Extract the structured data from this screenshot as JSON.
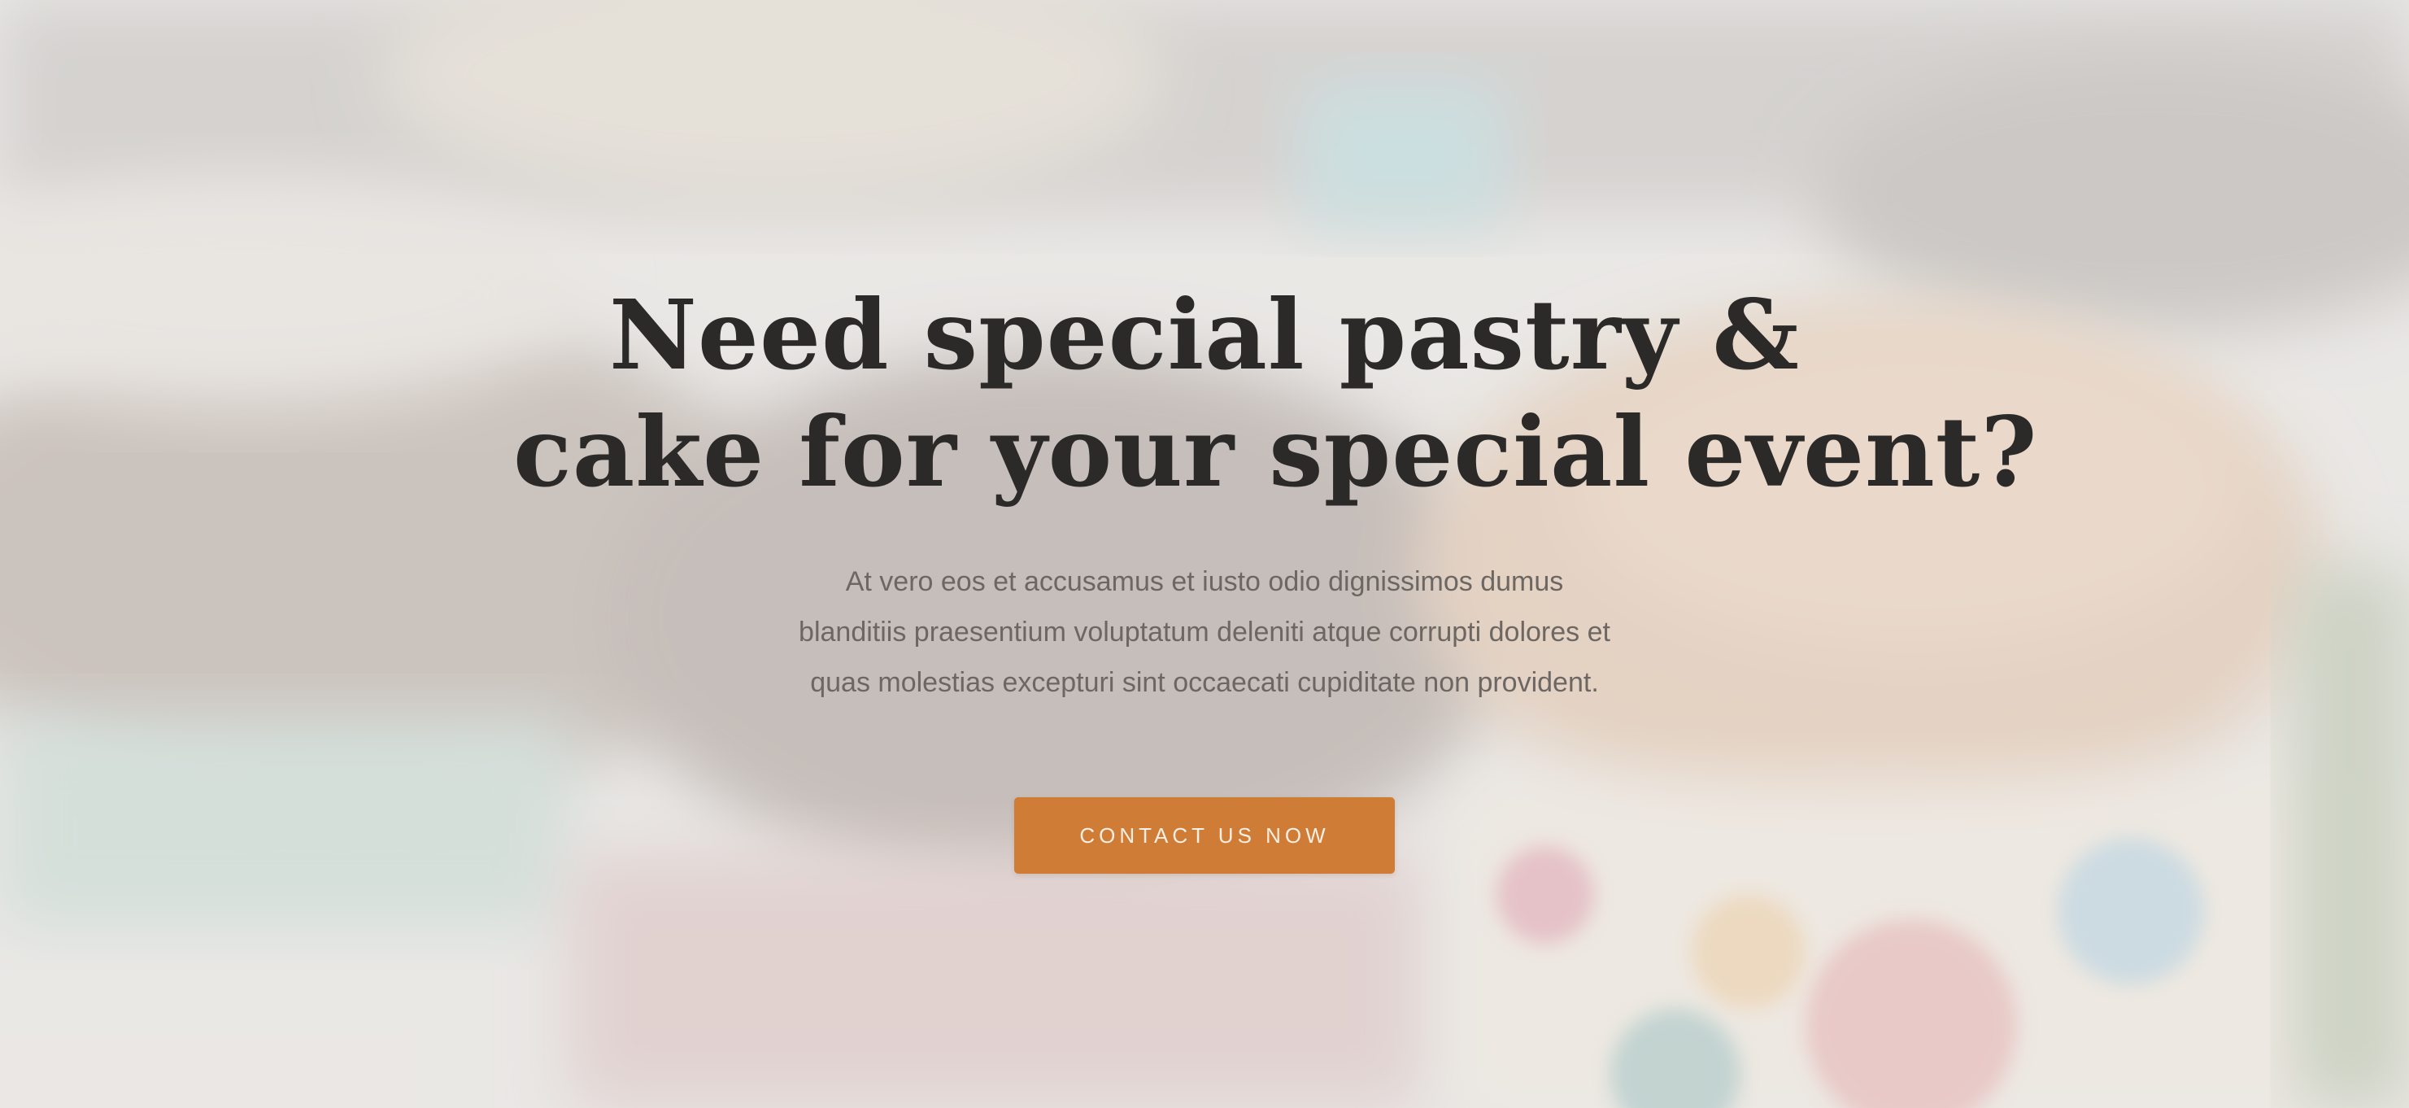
{
  "hero": {
    "title_line1": "Need special pastry &",
    "title_line2": "cake for your special event?",
    "text_line1": "At vero eos et accusamus et iusto odio dignissimos dumus",
    "text_line2": "blanditiis praesentium voluptatum deleniti atque corrupti dolores et",
    "text_line3": "quas molestias excepturi sint occaecati cupiditate non provident.",
    "cta_label": "CONTACT US NOW"
  },
  "colors": {
    "accent": "#cf7c36",
    "title": "#2b2a29",
    "body_text": "#6d6763",
    "overlay": "#f0eeec"
  },
  "background": {
    "subject": "blurred cupcakes photo"
  }
}
